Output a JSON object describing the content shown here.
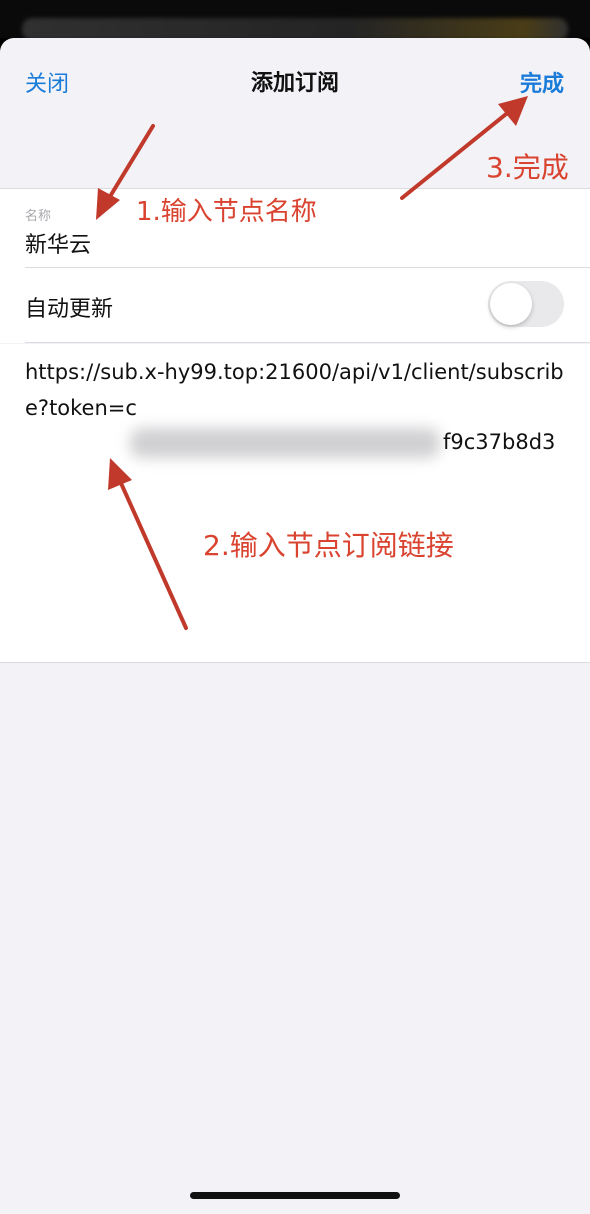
{
  "navbar": {
    "close_label": "关闭",
    "title": "添加订阅",
    "done_label": "完成"
  },
  "form": {
    "name_label": "名称",
    "name_value": "新华云",
    "auto_update_label": "自动更新",
    "auto_update_on": false,
    "url_visible": "https://sub.x-hy99.top:21600/api/v1/client/subscribe?token=c",
    "url_token_tail": "f9c37b8d3"
  },
  "annotations": {
    "step1": "1.输入节点名称",
    "step2": "2.输入节点订阅链接",
    "step3": "3.完成"
  },
  "colors": {
    "accent": "#1a7bd9",
    "annotation": "#d9432f",
    "background": "#f2f2f7"
  }
}
